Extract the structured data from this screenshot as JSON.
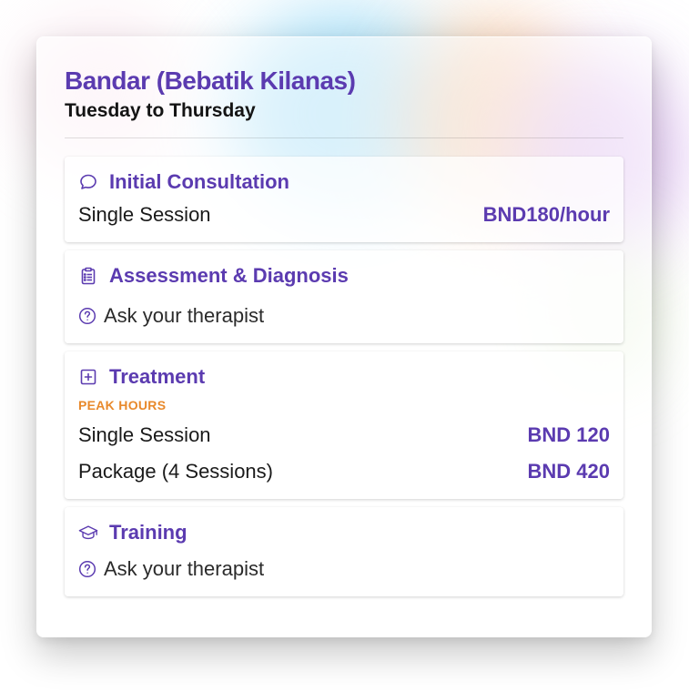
{
  "location": {
    "title": "Bandar (Bebatik Kilanas)",
    "days": "Tuesday to Thursday"
  },
  "services": [
    {
      "name": "Initial Consultation",
      "icon": "chat-bubble-icon",
      "rows": [
        {
          "label": "Single Session",
          "price": "BND180/hour"
        }
      ]
    },
    {
      "name": "Assessment & Diagnosis",
      "icon": "clipboard-icon",
      "ask_text": "Ask your therapist"
    },
    {
      "name": "Treatment",
      "icon": "plus-square-icon",
      "tag": "PEAK HOURS",
      "rows": [
        {
          "label": "Single Session",
          "price": "BND 120"
        },
        {
          "label": "Package (4 Sessions)",
          "price": "BND 420"
        }
      ]
    },
    {
      "name": "Training",
      "icon": "graduation-cap-icon",
      "ask_text": "Ask your therapist"
    }
  ],
  "colors": {
    "accent": "#5b3bb0",
    "peak_tag": "#e8892b",
    "text": "#141414"
  }
}
